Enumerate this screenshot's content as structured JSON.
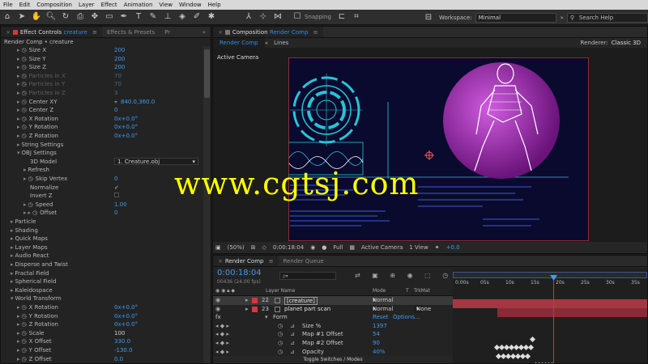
{
  "menu": [
    "File",
    "Edit",
    "Composition",
    "Layer",
    "Effect",
    "Animation",
    "View",
    "Window",
    "Help"
  ],
  "toolbar": {
    "snapping_label": "Snapping",
    "workspace_label": "Workspace:",
    "workspace_value": "Minimal",
    "search_placeholder": "Search Help"
  },
  "effect_panel": {
    "tab_effect_controls_prefix": "Effect Controls",
    "tab_effect_controls_layer": "creature",
    "tab_effects_presets": "Effects & Presets",
    "tab_overflow": "Pr",
    "header": "Render Comp • creature",
    "rows": [
      {
        "label": "Size X",
        "value": "200",
        "indent": 2,
        "stopwatch": true,
        "dim": false
      },
      {
        "label": "Size Y",
        "value": "200",
        "indent": 2,
        "stopwatch": true,
        "dim": false
      },
      {
        "label": "Size Z",
        "value": "200",
        "indent": 2,
        "stopwatch": true,
        "dim": false
      },
      {
        "label": "Particles in X",
        "value": "70",
        "indent": 2,
        "stopwatch": true,
        "dim": true
      },
      {
        "label": "Particles in Y",
        "value": "70",
        "indent": 2,
        "stopwatch": true,
        "dim": true
      },
      {
        "label": "Particles in Z",
        "value": "3",
        "indent": 2,
        "stopwatch": true,
        "dim": true
      },
      {
        "label": "Center XY",
        "value": "840.0,360.0",
        "indent": 2,
        "stopwatch": true,
        "dim": false,
        "crosshair": true
      },
      {
        "label": "Center Z",
        "value": "0",
        "indent": 2,
        "stopwatch": true,
        "dim": false
      },
      {
        "label": "X Rotation",
        "value": "0x+0.0°",
        "indent": 2,
        "stopwatch": true,
        "dim": false
      },
      {
        "label": "Y Rotation",
        "value": "0x+0.0°",
        "indent": 2,
        "stopwatch": true,
        "dim": false
      },
      {
        "label": "Z Rotation",
        "value": "0x+0.0°",
        "indent": 2,
        "stopwatch": true,
        "dim": false
      },
      {
        "label": "String Settings",
        "value": "",
        "indent": 2,
        "group": true,
        "open": false
      },
      {
        "label": "OBJ Settings",
        "value": "",
        "indent": 2,
        "group": true,
        "open": true
      },
      {
        "label": "3D Model",
        "value": "1. Creature.obj",
        "indent": 4,
        "dropdown": true
      },
      {
        "label": "Refresh",
        "value": "",
        "indent": 3,
        "group": true,
        "open": false
      },
      {
        "label": "Skip Vertex",
        "value": "0",
        "indent": 3,
        "stopwatch": true
      },
      {
        "label": "Normalize",
        "value": "✓",
        "indent": 4,
        "white": true
      },
      {
        "label": "Invert Z",
        "value": "",
        "indent": 4
      },
      {
        "label": "Speed",
        "value": "1.00",
        "indent": 3,
        "stopwatch": true
      },
      {
        "label": "Offset",
        "value": "0",
        "indent": 3,
        "stopwatch": true,
        "extra_tri": true
      },
      {
        "label": "Particle",
        "value": "",
        "indent": 1,
        "group": true,
        "open": false
      },
      {
        "label": "Shading",
        "value": "",
        "indent": 1,
        "group": true,
        "open": false
      },
      {
        "label": "Quick Maps",
        "value": "",
        "indent": 1,
        "group": true,
        "open": false
      },
      {
        "label": "Layer Maps",
        "value": "",
        "indent": 1,
        "group": true,
        "open": false
      },
      {
        "label": "Audio React",
        "value": "",
        "indent": 1,
        "group": true,
        "open": false
      },
      {
        "label": "Disperse and Twist",
        "value": "",
        "indent": 1,
        "group": true,
        "open": false
      },
      {
        "label": "Fractal Field",
        "value": "",
        "indent": 1,
        "group": true,
        "open": false
      },
      {
        "label": "Spherical Field",
        "value": "",
        "indent": 1,
        "group": true,
        "open": false
      },
      {
        "label": "Kaleidospace",
        "value": "",
        "indent": 1,
        "group": true,
        "open": false
      },
      {
        "label": "World Transform",
        "value": "",
        "indent": 1,
        "group": true,
        "open": true
      },
      {
        "label": "X Rotation",
        "value": "0x+0.0°",
        "indent": 2,
        "stopwatch": true
      },
      {
        "label": "Y Rotation",
        "value": "0x+0.0°",
        "indent": 2,
        "stopwatch": true
      },
      {
        "label": "Z Rotation",
        "value": "0x+0.0°",
        "indent": 2,
        "stopwatch": true
      },
      {
        "label": "Scale",
        "value": "100",
        "indent": 2,
        "stopwatch": true,
        "white": true
      },
      {
        "label": "X Offset",
        "value": "330.0",
        "indent": 2,
        "stopwatch": true
      },
      {
        "label": "Y Offset",
        "value": "-130.0",
        "indent": 2,
        "stopwatch": true
      },
      {
        "label": "Z Offset",
        "value": "0.0",
        "indent": 2,
        "stopwatch": true
      }
    ]
  },
  "comp_panel": {
    "tab_prefix": "Composition",
    "tab_name": "Render Comp",
    "subtabs": [
      "Render Comp",
      "Lines"
    ],
    "renderer_label": "Renderer:",
    "renderer_value": "Classic 3D",
    "active_camera_label": "Active Camera",
    "footer": {
      "zoom": "(50%)",
      "timecode": "0:00:18:04",
      "resolution": "Full",
      "view": "Active Camera",
      "views": "1 View",
      "exposure": "+0.0"
    }
  },
  "watermark": "www.cgtsj.com",
  "timeline": {
    "tab_render_comp": "Render Comp",
    "tab_render_queue": "Render Queue",
    "timecode": "0:00:18:04",
    "frame_info": "00436 (24.00 fps)",
    "search_placeholder": "ρ▾",
    "col_layer_name": "Layer Name",
    "col_mode": "Mode",
    "col_t": "T",
    "col_trkmat": "TrkMat",
    "ruler": [
      "0:00s",
      "05s",
      "10s",
      "15s",
      "20s",
      "25s",
      "30s",
      "35s"
    ],
    "playhead_fraction": 0.517,
    "layers": [
      {
        "num": "22",
        "name": "[creature]",
        "mode": "Normal",
        "trkmat": "",
        "selected": true
      },
      {
        "num": "23",
        "name": "planet part scan",
        "mode": "Normal",
        "trkmat": "None",
        "selected": false
      }
    ],
    "sub_rows": [
      {
        "label": "Form",
        "value": "Reset",
        "value2": "Options...",
        "type": "fx"
      },
      {
        "label": "Size %",
        "value": "1397",
        "type": "prop"
      },
      {
        "label": "Map #1 Offset",
        "value": "54",
        "type": "prop"
      },
      {
        "label": "Map #2 Offset",
        "value": "90",
        "type": "prop"
      },
      {
        "label": "Opacity",
        "value": "40%",
        "type": "prop"
      }
    ],
    "footer_label": "Toggle Switches / Modes"
  },
  "colors": {
    "accent": "#2d8ceb",
    "layer_red": "#d8373d",
    "bar_red": "#b23a48",
    "viewer_bg": "#0a0a2e",
    "hud_cyan": "#27c4d8",
    "planet": "#b524c9",
    "watermark": "#ffff00"
  }
}
